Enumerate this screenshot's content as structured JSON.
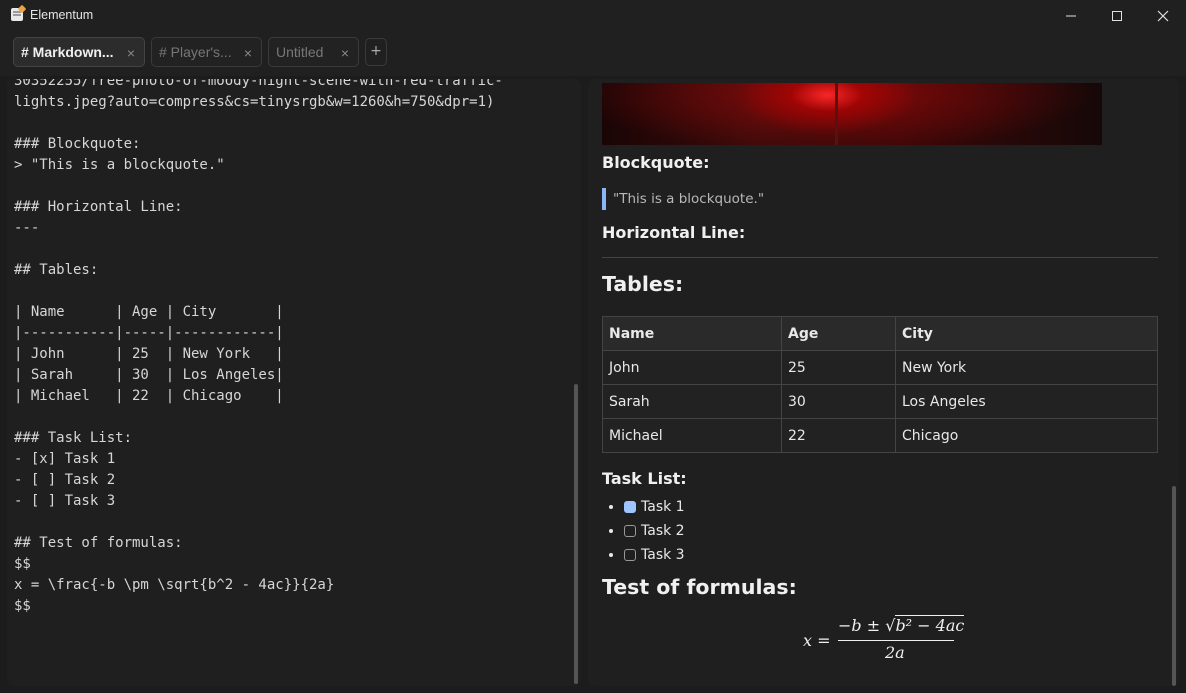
{
  "window": {
    "title": "Elementum"
  },
  "tabs": [
    {
      "label": "# Markdown...",
      "active": true
    },
    {
      "label": "# Player's...",
      "active": false
    },
    {
      "label": "Untitled",
      "active": false
    }
  ],
  "new_tab_label": "+",
  "editor": {
    "lines": [
      "30352255/free-photo-of-moody-night-scene-with-red-traffic-",
      "lights.jpeg?auto=compress&cs=tinysrgb&w=1260&h=750&dpr=1)",
      "",
      "### Blockquote:",
      "> \"This is a blockquote.\"",
      "",
      "### Horizontal Line:",
      "---",
      "",
      "## Tables:",
      "",
      "| Name      | Age | City       |",
      "|-----------|-----|------------|",
      "| John      | 25  | New York   |",
      "| Sarah     | 30  | Los Angeles|",
      "| Michael   | 22  | Chicago    |",
      "",
      "### Task List:",
      "- [x] Task 1",
      "- [ ] Task 2",
      "- [ ] Task 3",
      "",
      "## Test of formulas:",
      "$$",
      "x = \\frac{-b \\pm \\sqrt{b^2 - 4ac}}{2a}",
      "$$"
    ]
  },
  "preview": {
    "blockquote_heading": "Blockquote:",
    "blockquote_text": "\"This is a blockquote.\"",
    "hr_heading": "Horizontal Line:",
    "tables_heading": "Tables:",
    "table": {
      "headers": [
        "Name",
        "Age",
        "City"
      ],
      "rows": [
        [
          "John",
          "25",
          "New York"
        ],
        [
          "Sarah",
          "30",
          "Los Angeles"
        ],
        [
          "Michael",
          "22",
          "Chicago"
        ]
      ]
    },
    "tasks_heading": "Task List:",
    "tasks": [
      {
        "label": "Task 1",
        "checked": true
      },
      {
        "label": "Task 2",
        "checked": false
      },
      {
        "label": "Task 3",
        "checked": false
      }
    ],
    "formulas_heading": "Test of formulas:",
    "formula": {
      "lhs": "x =",
      "numerator_prefix": "−b ± ",
      "radicand": "b² − 4ac",
      "denominator": "2a"
    }
  },
  "colors": {
    "accent": "#8ab4f8",
    "checkbox_checked": "#9ec5ff",
    "image_red": "#ff2020"
  }
}
